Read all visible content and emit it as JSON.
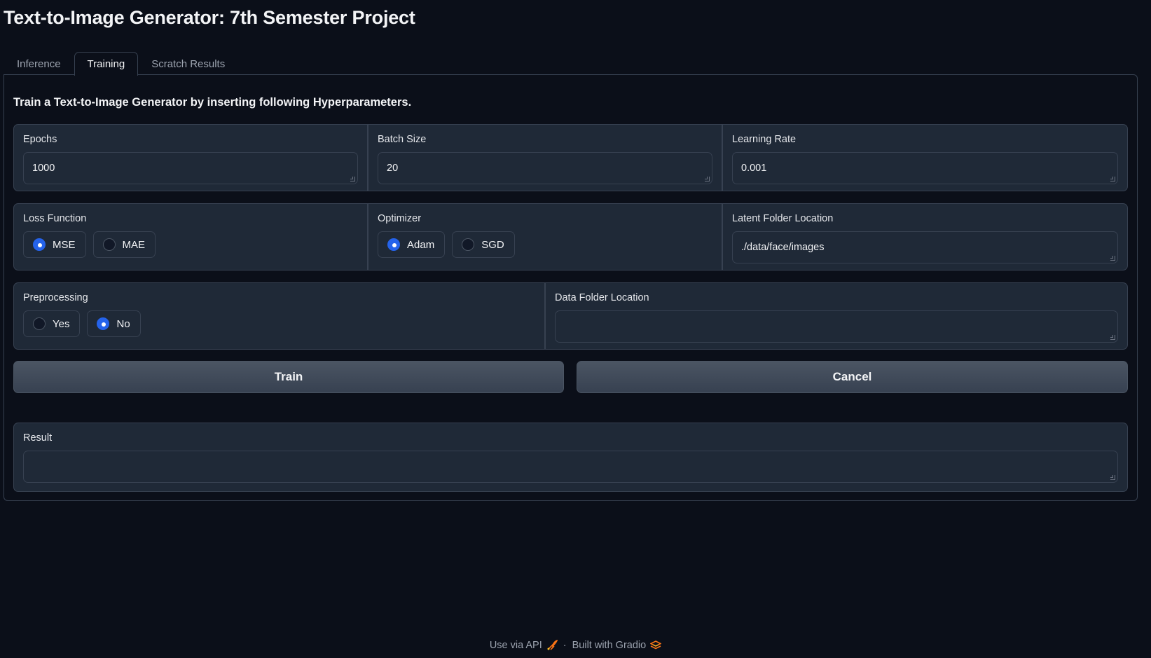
{
  "title": "Text-to-Image Generator: 7th Semester Project",
  "tabs": [
    {
      "label": "Inference",
      "active": false
    },
    {
      "label": "Training",
      "active": true
    },
    {
      "label": "Scratch Results",
      "active": false
    }
  ],
  "description": "Train a Text-to-Image Generator by inserting following Hyperparameters.",
  "epochs": {
    "label": "Epochs",
    "value": "1000"
  },
  "batch_size": {
    "label": "Batch Size",
    "value": "20"
  },
  "learning_rate": {
    "label": "Learning Rate",
    "value": "0.001"
  },
  "loss_function": {
    "label": "Loss Function",
    "options": [
      "MSE",
      "MAE"
    ],
    "selected": "MSE"
  },
  "optimizer": {
    "label": "Optimizer",
    "options": [
      "Adam",
      "SGD"
    ],
    "selected": "Adam"
  },
  "latent_folder": {
    "label": "Latent Folder Location",
    "value": "./data/face/images"
  },
  "preprocessing": {
    "label": "Preprocessing",
    "options": [
      "Yes",
      "No"
    ],
    "selected": "No"
  },
  "data_folder": {
    "label": "Data Folder Location",
    "value": ""
  },
  "buttons": {
    "train": "Train",
    "cancel": "Cancel"
  },
  "result": {
    "label": "Result",
    "value": ""
  },
  "footer": {
    "api": "Use via API",
    "separator": "·",
    "built": "Built with Gradio",
    "api_icon": "rocket-icon",
    "gradio_icon": "gradio-logo-icon"
  },
  "colors": {
    "background": "#0b0f19",
    "panel": "#1f2937",
    "border": "#374151",
    "accent": "#2563eb",
    "gradio": "#f97316"
  }
}
